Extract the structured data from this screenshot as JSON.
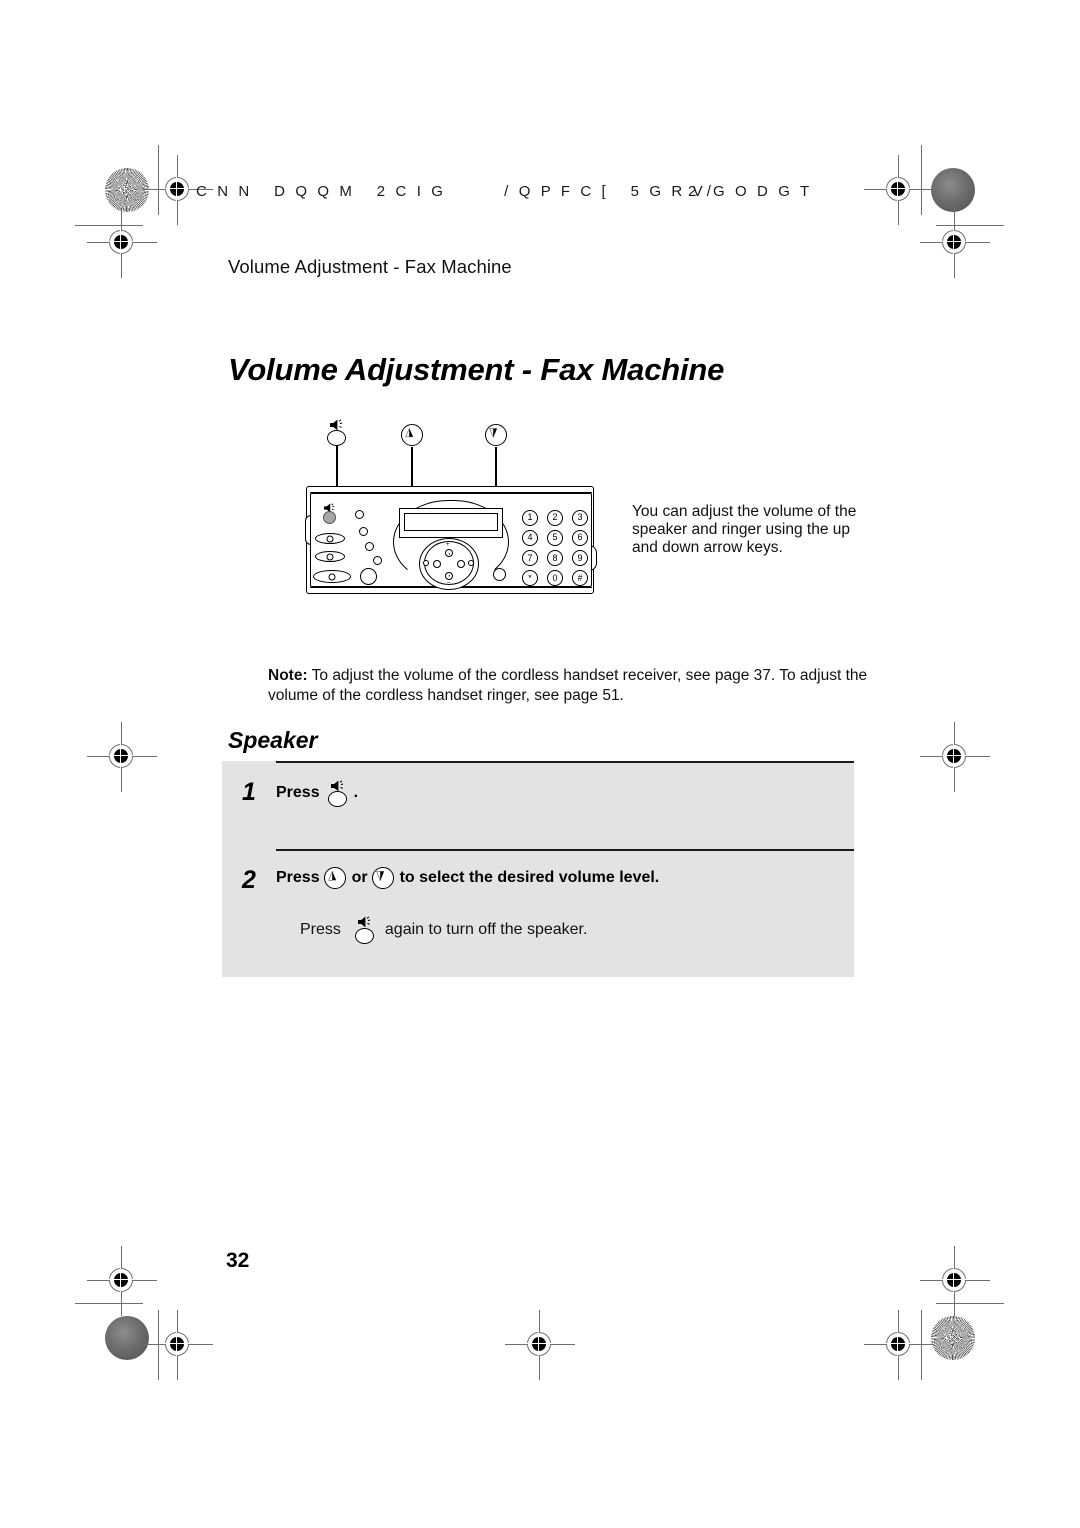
{
  "document": {
    "running_header": "C N N   D Q Q M   2 C I G        / Q P F C [   5 G R V G O D G T",
    "running_header_page": "2 /",
    "section_label": "Volume Adjustment - Fax Machine",
    "page_title": "Volume Adjustment - Fax Machine",
    "page_number": "32"
  },
  "intro": {
    "text": "You can adjust the volume of the speaker and ringer using the up and down arrow keys."
  },
  "note": {
    "label": "Note:",
    "text": " To adjust the volume of the cordless handset receiver, see page 37. To adjust the volume of the cordless handset ringer, see page 51."
  },
  "subhead": {
    "text": "Speaker"
  },
  "steps": [
    {
      "number": "1",
      "text_before": "Press",
      "text_after": "."
    },
    {
      "number": "2",
      "text_before": "Press",
      "text_middle": "or",
      "text_after": "to select the desired volume level.",
      "substep_before": "Press",
      "substep_after": "again to turn off the speaker."
    }
  ],
  "illustration": {
    "callouts": [
      {
        "name": "speaker-key",
        "icon": "speaker-icon"
      },
      {
        "name": "up-arrow-key",
        "icon": "arrow-up-icon"
      },
      {
        "name": "down-arrow-key",
        "icon": "arrow-down-icon"
      }
    ],
    "keypad": [
      "1",
      "2",
      "3",
      "4",
      "5",
      "6",
      "7",
      "8",
      "9",
      "*",
      "0",
      "#"
    ],
    "dial_signs": {
      "up": "+",
      "down": "–"
    }
  },
  "colors": {
    "page_background": "#ffffff",
    "text": "#111111",
    "step_box_background": "#e3e3e3",
    "step_rule": "#1a1a1a",
    "speaker_button_fill": "#a8a8a8",
    "registration_mark": "#6e6e6e"
  }
}
